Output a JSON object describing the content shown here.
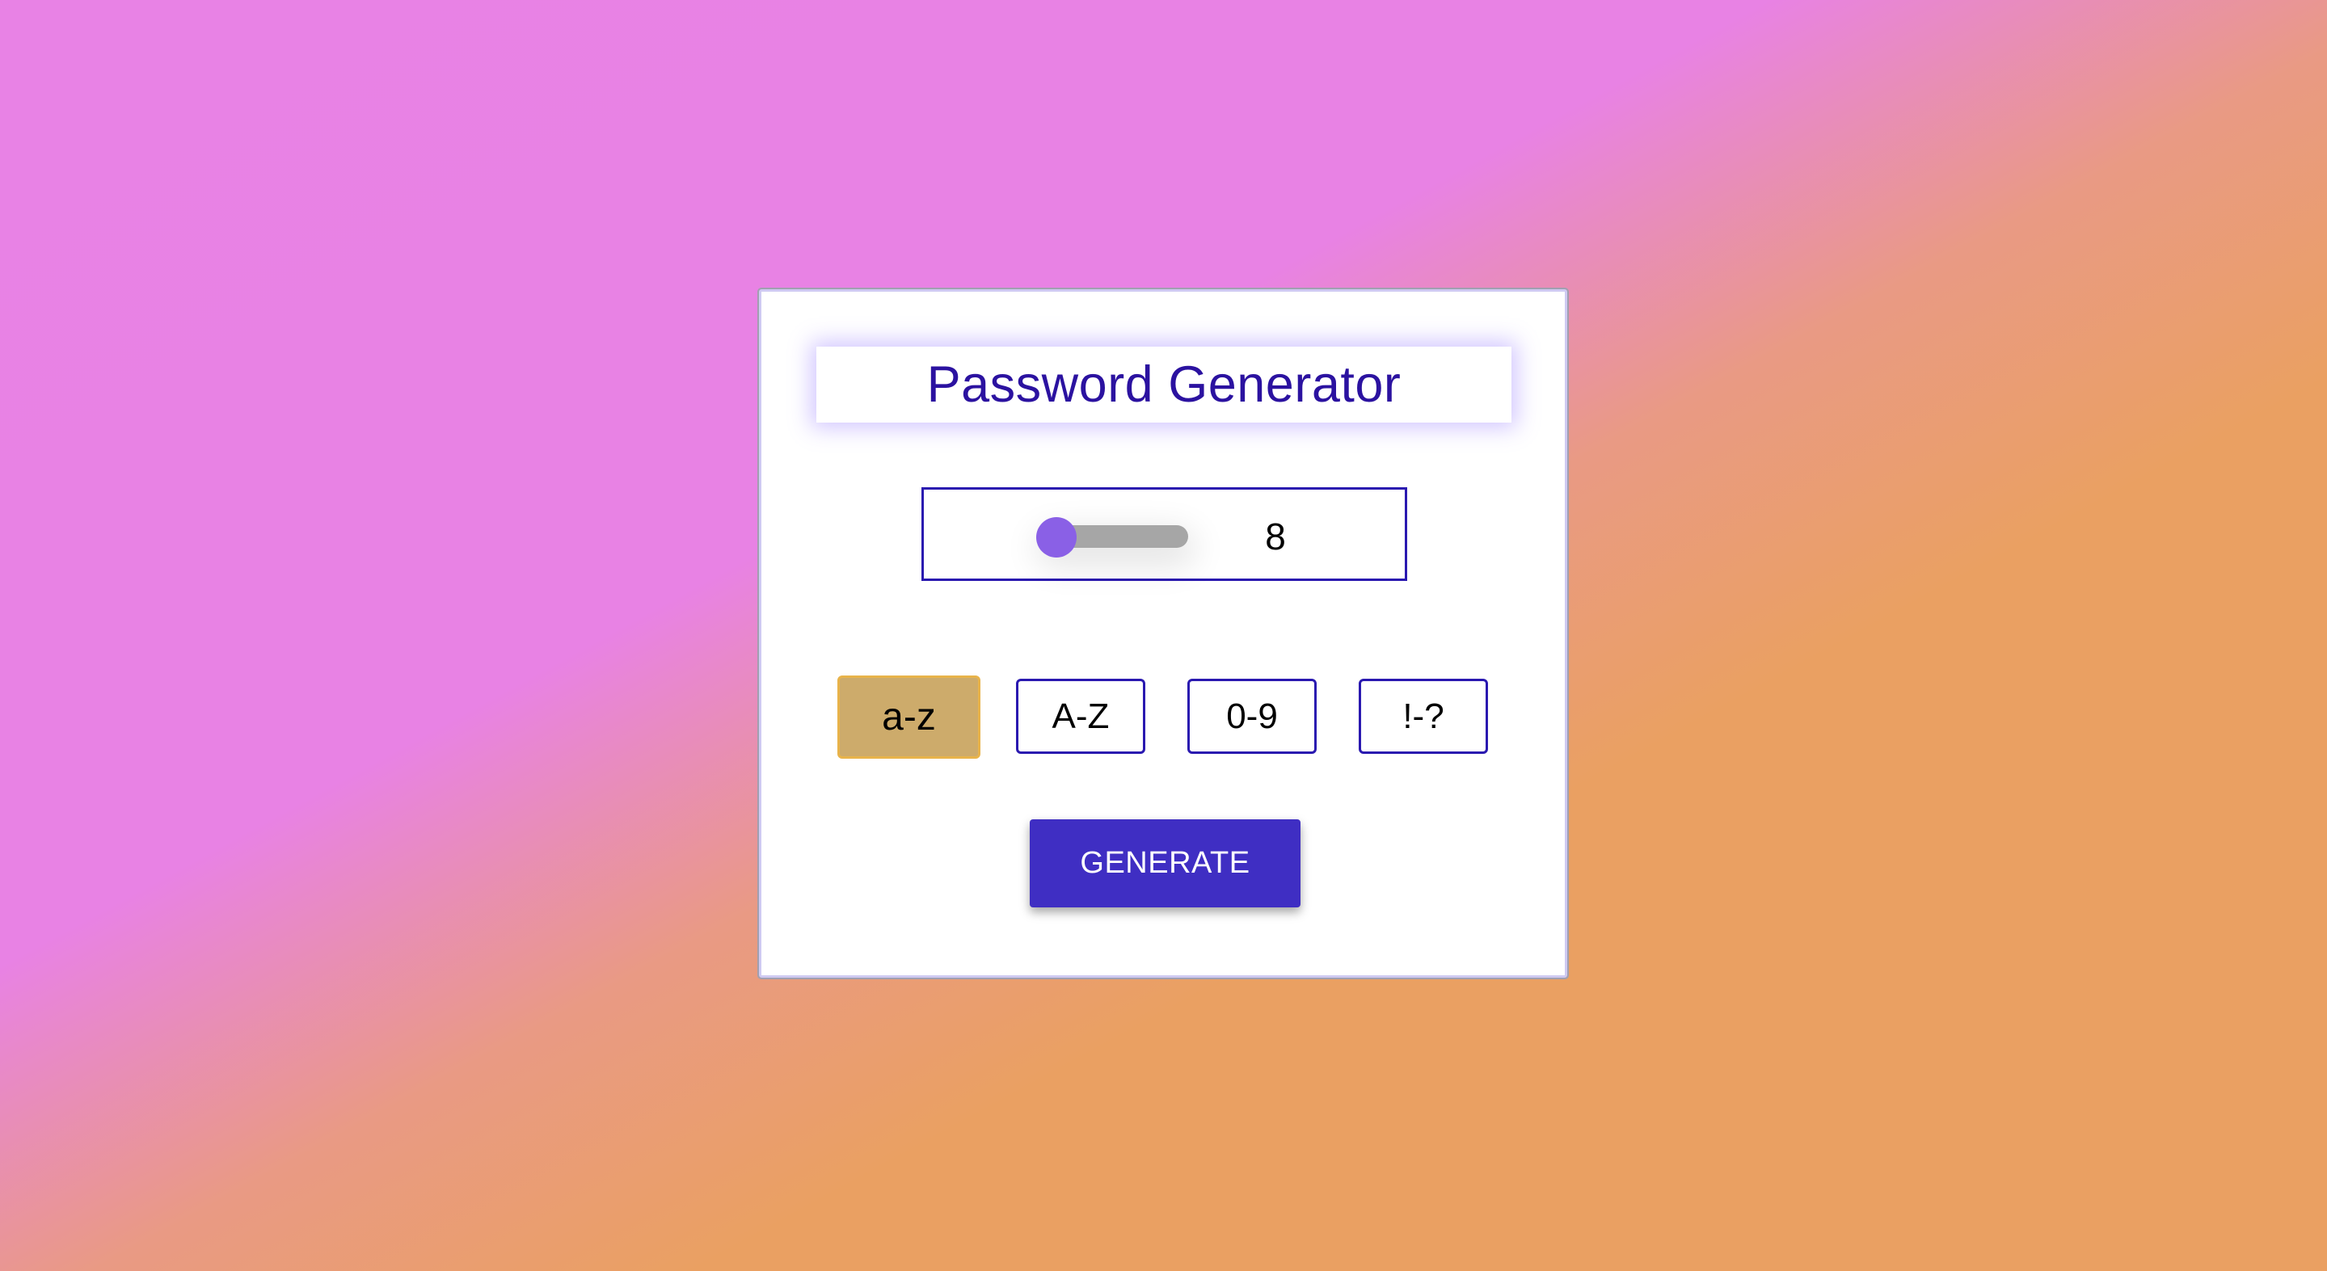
{
  "app": {
    "title": "Password Generator"
  },
  "length": {
    "value": "8",
    "slider_fraction": 0.0
  },
  "options": [
    {
      "label": "a-z",
      "active": true
    },
    {
      "label": "A-Z",
      "active": false
    },
    {
      "label": "0-9",
      "active": false
    },
    {
      "label": "!-?",
      "active": false
    }
  ],
  "actions": {
    "generate_label": "GENERATE"
  },
  "colors": {
    "title_text": "#2b12a0",
    "accent_border": "#2a19b0",
    "slider_thumb": "#8a60e6",
    "slider_track": "#a6a6a6",
    "active_option_bg": "#cdab6b",
    "active_option_border": "#e8b34a",
    "generate_button_bg": "#3f2ec3"
  }
}
